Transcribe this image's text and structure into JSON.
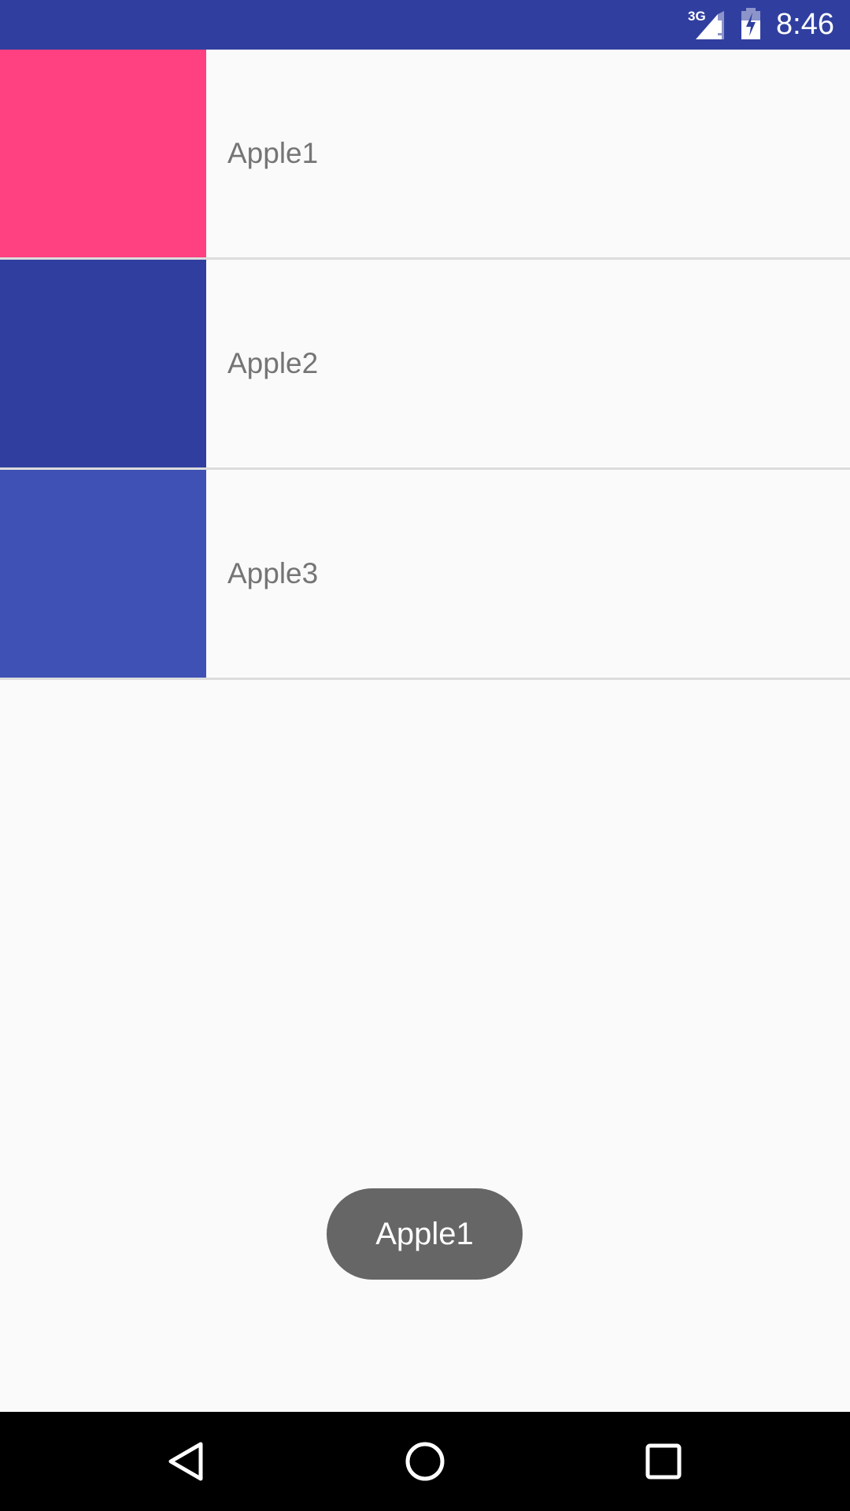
{
  "status_bar": {
    "network_type": "3G",
    "time": "8:46",
    "background_color": "#303f9f",
    "icons": [
      "signal-icon",
      "battery-icon"
    ]
  },
  "list": {
    "items": [
      {
        "label": "Apple1",
        "color": "#ff4081"
      },
      {
        "label": "Apple2",
        "color": "#303f9f"
      },
      {
        "label": "Apple3",
        "color": "#3f51b5"
      }
    ]
  },
  "toast": {
    "text": "Apple1"
  },
  "nav_bar": {
    "icons": [
      "back-icon",
      "home-icon",
      "recents-icon"
    ]
  }
}
